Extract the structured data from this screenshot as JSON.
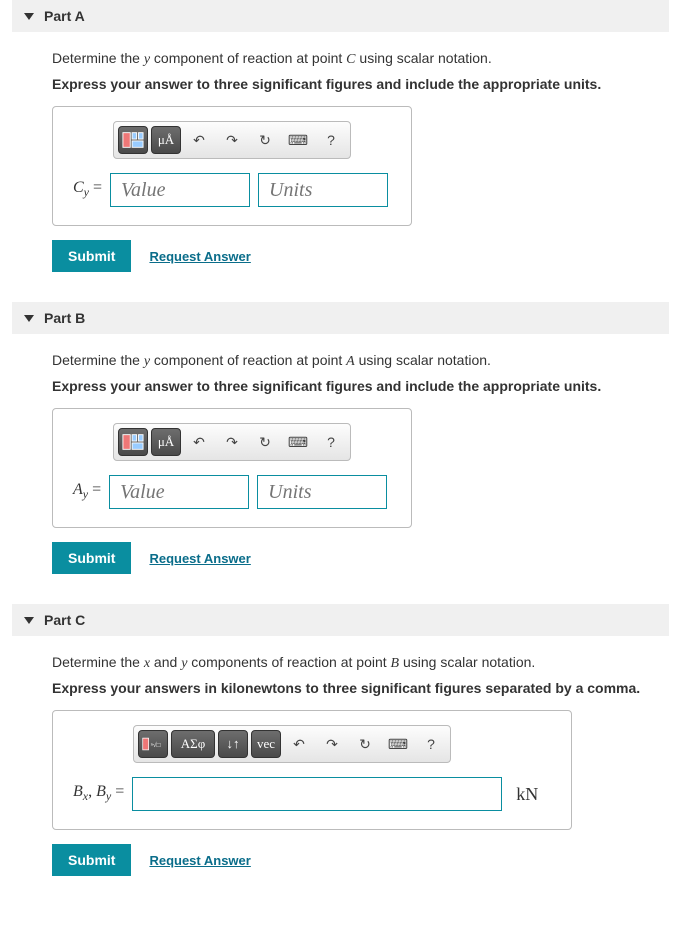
{
  "common": {
    "submit_label": "Submit",
    "request_label": "Request Answer",
    "value_placeholder": "Value",
    "units_placeholder": "Units",
    "help_char": "?",
    "mu_angstrom": "μÅ",
    "gk1": "ΑΣφ",
    "updown": "↓↑",
    "vec": "vec"
  },
  "partA": {
    "title": "Part A",
    "prompt_pre": "Determine the ",
    "prompt_var": "y",
    "prompt_mid": " component of reaction at point ",
    "prompt_pt": "C",
    "prompt_post": " using scalar notation.",
    "instr": "Express your answer to three significant figures and include the appropriate units.",
    "lhs_main": "C",
    "lhs_sub": "y"
  },
  "partB": {
    "title": "Part B",
    "prompt_pre": "Determine the ",
    "prompt_var": "y",
    "prompt_mid": " component of reaction at point ",
    "prompt_pt": "A",
    "prompt_post": " using scalar notation.",
    "instr": "Express your answer to three significant figures and include the appropriate units.",
    "lhs_main": "A",
    "lhs_sub": "y"
  },
  "partC": {
    "title": "Part C",
    "prompt_pre": "Determine the ",
    "prompt_v1": "x",
    "prompt_and": " and ",
    "prompt_v2": "y",
    "prompt_mid": " components of reaction at point ",
    "prompt_pt": "B",
    "prompt_post": " using scalar notation.",
    "instr": "Express your answers in kilonewtons to three significant figures separated by a comma.",
    "lhs1_main": "B",
    "lhs1_sub": "x",
    "lhs2_main": "B",
    "lhs2_sub": "y",
    "unit": "kN"
  }
}
